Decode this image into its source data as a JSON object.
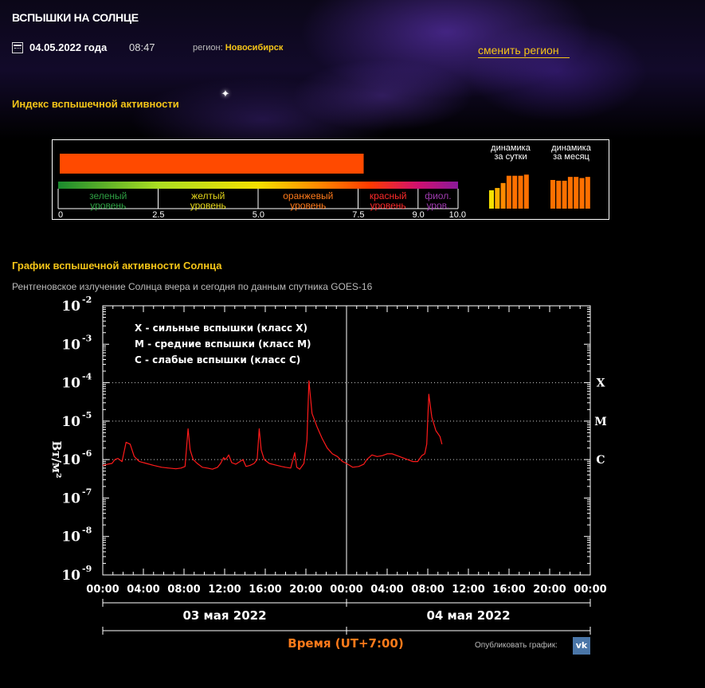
{
  "header": {
    "title": "ВСПЫШКИ НА СОЛНЦЕ",
    "date": "04.05.2022 года",
    "time": "08:47",
    "region_label": "регион:",
    "region_value": "Новосибирск",
    "change_region": "сменить регион"
  },
  "index": {
    "heading": "Индекс вспышечной активности",
    "value": 7.6,
    "max": 10,
    "bar_color": "#ff4a00",
    "levels": [
      {
        "label1": "зеленый",
        "label2": "уровень",
        "from": 0,
        "to": 2.5,
        "color": "#2ea043"
      },
      {
        "label1": "желтый",
        "label2": "уровень",
        "from": 2.5,
        "to": 5.0,
        "color": "#e6d81a"
      },
      {
        "label1": "оранжевый",
        "label2": "уровень",
        "from": 5.0,
        "to": 7.5,
        "color": "#ff7a1a"
      },
      {
        "label1": "красный",
        "label2": "уровень",
        "from": 7.5,
        "to": 9.0,
        "color": "#ff2a2a"
      },
      {
        "label1": "фиол.",
        "label2": "уров.",
        "from": 9.0,
        "to": 10.0,
        "color": "#a03ab0"
      }
    ],
    "scale_ticks": [
      "0",
      "2.5",
      "5.0",
      "7.5",
      "9.0",
      "10.0"
    ],
    "dynamics_day_label1": "динамика",
    "dynamics_day_label2": "за сутки",
    "dynamics_month_label1": "динамика",
    "dynamics_month_label2": "за месяц",
    "dynamics_day": [
      {
        "value": 4.8,
        "color": "#f5e000"
      },
      {
        "value": 5.4,
        "color": "#ffb000"
      },
      {
        "value": 6.7,
        "color": "#ff8a00"
      },
      {
        "value": 8.6,
        "color": "#ff7000"
      },
      {
        "value": 8.6,
        "color": "#ff7000"
      },
      {
        "value": 8.6,
        "color": "#ff7000"
      },
      {
        "value": 8.9,
        "color": "#ff7000"
      }
    ],
    "dynamics_month": [
      {
        "value": 7.5,
        "color": "#ff7000"
      },
      {
        "value": 7.3,
        "color": "#ff7000"
      },
      {
        "value": 7.3,
        "color": "#ff7000"
      },
      {
        "value": 8.3,
        "color": "#ff7000"
      },
      {
        "value": 8.3,
        "color": "#ff7000"
      },
      {
        "value": 8.0,
        "color": "#ff7000"
      },
      {
        "value": 8.3,
        "color": "#ff7000"
      }
    ]
  },
  "graph": {
    "heading": "График вспышечной активности Солнца",
    "subtitle": "Рентгеновское излучение Солнца вчера и сегодня по данным спутника GOES-16",
    "publish_label": "Опубликовать график:",
    "vk_label": "vk"
  },
  "chart_data": {
    "type": "line",
    "ylabel": "Вт/м²",
    "xlabel": "Время (UT+7:00)",
    "y_scale": "log",
    "ylim_exp": [
      -9,
      -2
    ],
    "y_ticks": [
      {
        "base": "10",
        "exp": "-2"
      },
      {
        "base": "10",
        "exp": "-3"
      },
      {
        "base": "10",
        "exp": "-4"
      },
      {
        "base": "10",
        "exp": "-5"
      },
      {
        "base": "10",
        "exp": "-6"
      },
      {
        "base": "10",
        "exp": "-7"
      },
      {
        "base": "10",
        "exp": "-8"
      },
      {
        "base": "10",
        "exp": "-9"
      }
    ],
    "x_ticks": [
      "00:00",
      "04:00",
      "08:00",
      "12:00",
      "16:00",
      "20:00",
      "00:00",
      "04:00",
      "08:00",
      "12:00",
      "16:00",
      "20:00",
      "00:00"
    ],
    "x_range_hours": [
      0,
      48
    ],
    "days": [
      {
        "label": "03 мая 2022",
        "from_h": 0,
        "to_h": 24
      },
      {
        "label": "04 мая 2022",
        "from_h": 24,
        "to_h": 48
      }
    ],
    "class_lines": [
      {
        "label": "X",
        "exp": -4
      },
      {
        "label": "M",
        "exp": -5
      },
      {
        "label": "C",
        "exp": -6
      }
    ],
    "legend": [
      {
        "key": "X",
        "text": " - сильные вспышки (класс X)"
      },
      {
        "key": "M",
        "text": " - средние вспышки (класс M)"
      },
      {
        "key": "C",
        "text": " - слабые вспышки (класс C)"
      }
    ],
    "legend_position": "top-left",
    "series": [
      {
        "color": "#ff1a1a",
        "points": [
          [
            0.0,
            -6.15
          ],
          [
            0.5,
            -6.12
          ],
          [
            0.9,
            -6.1
          ],
          [
            1.2,
            -6.0
          ],
          [
            1.5,
            -5.97
          ],
          [
            1.9,
            -6.05
          ],
          [
            2.3,
            -5.55
          ],
          [
            2.7,
            -5.6
          ],
          [
            3.1,
            -5.92
          ],
          [
            3.6,
            -6.05
          ],
          [
            4.3,
            -6.1
          ],
          [
            5.0,
            -6.15
          ],
          [
            5.8,
            -6.2
          ],
          [
            6.5,
            -6.22
          ],
          [
            7.2,
            -6.24
          ],
          [
            7.7,
            -6.22
          ],
          [
            8.1,
            -6.18
          ],
          [
            8.4,
            -5.2
          ],
          [
            8.6,
            -5.75
          ],
          [
            8.9,
            -6.0
          ],
          [
            9.3,
            -6.1
          ],
          [
            9.8,
            -6.2
          ],
          [
            10.3,
            -6.22
          ],
          [
            10.8,
            -6.25
          ],
          [
            11.3,
            -6.2
          ],
          [
            11.6,
            -6.1
          ],
          [
            11.9,
            -5.95
          ],
          [
            12.1,
            -6.0
          ],
          [
            12.4,
            -5.88
          ],
          [
            12.7,
            -6.08
          ],
          [
            13.1,
            -6.12
          ],
          [
            13.5,
            -6.05
          ],
          [
            13.8,
            -6.0
          ],
          [
            14.1,
            -6.18
          ],
          [
            14.5,
            -6.15
          ],
          [
            14.9,
            -6.1
          ],
          [
            15.2,
            -6.0
          ],
          [
            15.4,
            -5.2
          ],
          [
            15.6,
            -5.75
          ],
          [
            15.9,
            -6.0
          ],
          [
            16.4,
            -6.1
          ],
          [
            17.0,
            -6.14
          ],
          [
            17.6,
            -6.18
          ],
          [
            18.0,
            -6.2
          ],
          [
            18.5,
            -6.22
          ],
          [
            18.9,
            -5.82
          ],
          [
            19.1,
            -6.2
          ],
          [
            19.4,
            -6.25
          ],
          [
            19.8,
            -6.1
          ],
          [
            20.1,
            -5.5
          ],
          [
            20.3,
            -3.95
          ],
          [
            20.6,
            -4.8
          ],
          [
            21.1,
            -5.15
          ],
          [
            21.6,
            -5.45
          ],
          [
            22.1,
            -5.7
          ],
          [
            22.6,
            -5.85
          ],
          [
            23.1,
            -5.92
          ],
          [
            23.6,
            -6.05
          ],
          [
            24.0,
            -6.1
          ],
          [
            24.6,
            -6.2
          ],
          [
            25.2,
            -6.18
          ],
          [
            25.7,
            -6.12
          ],
          [
            26.0,
            -6.0
          ],
          [
            26.5,
            -5.88
          ],
          [
            27.0,
            -5.92
          ],
          [
            27.5,
            -5.9
          ],
          [
            28.0,
            -5.85
          ],
          [
            28.5,
            -5.85
          ],
          [
            29.0,
            -5.9
          ],
          [
            29.5,
            -5.95
          ],
          [
            30.0,
            -6.0
          ],
          [
            30.5,
            -6.05
          ],
          [
            31.0,
            -6.05
          ],
          [
            31.4,
            -5.9
          ],
          [
            31.7,
            -5.85
          ],
          [
            31.9,
            -5.6
          ],
          [
            32.1,
            -4.3
          ],
          [
            32.4,
            -4.9
          ],
          [
            32.8,
            -5.25
          ],
          [
            33.2,
            -5.4
          ],
          [
            33.4,
            -5.6
          ]
        ]
      }
    ]
  }
}
